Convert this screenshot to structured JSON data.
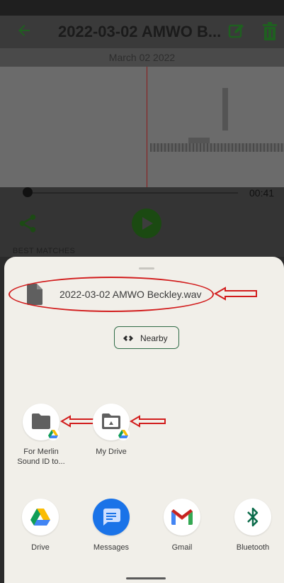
{
  "app": {
    "title": "2022-03-02 AMWO B...",
    "date": "March 02 2022",
    "time": "00:41",
    "best_matches": "BEST MATCHES"
  },
  "share_sheet": {
    "file_name": "2022-03-02 AMWO Beckley.wav",
    "nearby_label": "Nearby",
    "targets": [
      {
        "label": "For Merlin\nSound ID to...",
        "icon": "folder-icon"
      },
      {
        "label": "My Drive",
        "icon": "drive-folder-icon"
      }
    ],
    "apps": [
      {
        "label": "Drive",
        "icon": "google-drive-icon"
      },
      {
        "label": "Messages",
        "icon": "messages-icon"
      },
      {
        "label": "Gmail",
        "icon": "gmail-icon"
      },
      {
        "label": "Bluetooth",
        "icon": "bluetooth-icon"
      }
    ]
  },
  "colors": {
    "annotation_red": "#d21d1d",
    "app_green": "#1b4a12",
    "sheet_bg": "#f1efe9"
  }
}
